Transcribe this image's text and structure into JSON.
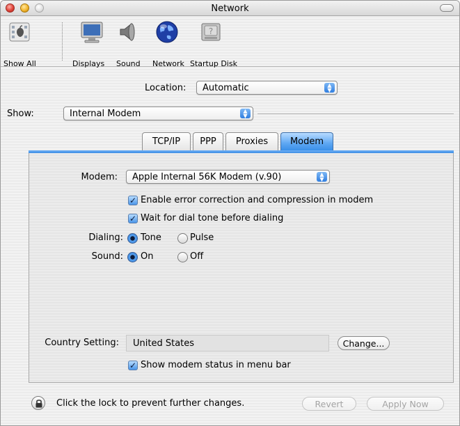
{
  "window": {
    "title": "Network"
  },
  "toolbar": {
    "items": [
      {
        "label": "Show All",
        "icon": "show-all-icon"
      },
      {
        "label": "Displays",
        "icon": "displays-icon"
      },
      {
        "label": "Sound",
        "icon": "sound-icon"
      },
      {
        "label": "Network",
        "icon": "network-globe-icon"
      },
      {
        "label": "Startup Disk",
        "icon": "startup-disk-icon"
      }
    ]
  },
  "location": {
    "label": "Location:",
    "value": "Automatic"
  },
  "show": {
    "label": "Show:",
    "value": "Internal Modem"
  },
  "tabs": [
    {
      "label": "TCP/IP",
      "selected": false
    },
    {
      "label": "PPP",
      "selected": false
    },
    {
      "label": "Proxies",
      "selected": false
    },
    {
      "label": "Modem",
      "selected": true
    }
  ],
  "modem": {
    "label": "Modem:",
    "value": "Apple Internal 56K Modem (v.90)",
    "error_correction": {
      "label": "Enable error correction and compression in modem",
      "checked": true
    },
    "wait_dial_tone": {
      "label": "Wait for dial tone before dialing",
      "checked": true
    },
    "dialing": {
      "label": "Dialing:",
      "options": [
        "Tone",
        "Pulse"
      ],
      "selected": "Tone"
    },
    "sound": {
      "label": "Sound:",
      "options": [
        "On",
        "Off"
      ],
      "selected": "On"
    },
    "country": {
      "label": "Country Setting:",
      "value": "United States",
      "change_button": "Change..."
    },
    "show_status": {
      "label": "Show modem status in menu bar",
      "checked": true
    }
  },
  "footer": {
    "lock_text": "Click the lock to prevent further changes.",
    "revert": "Revert",
    "apply": "Apply Now"
  },
  "colors": {
    "accent_blue": "#3a8fe8",
    "selected_tab": "#5ea7f3"
  }
}
